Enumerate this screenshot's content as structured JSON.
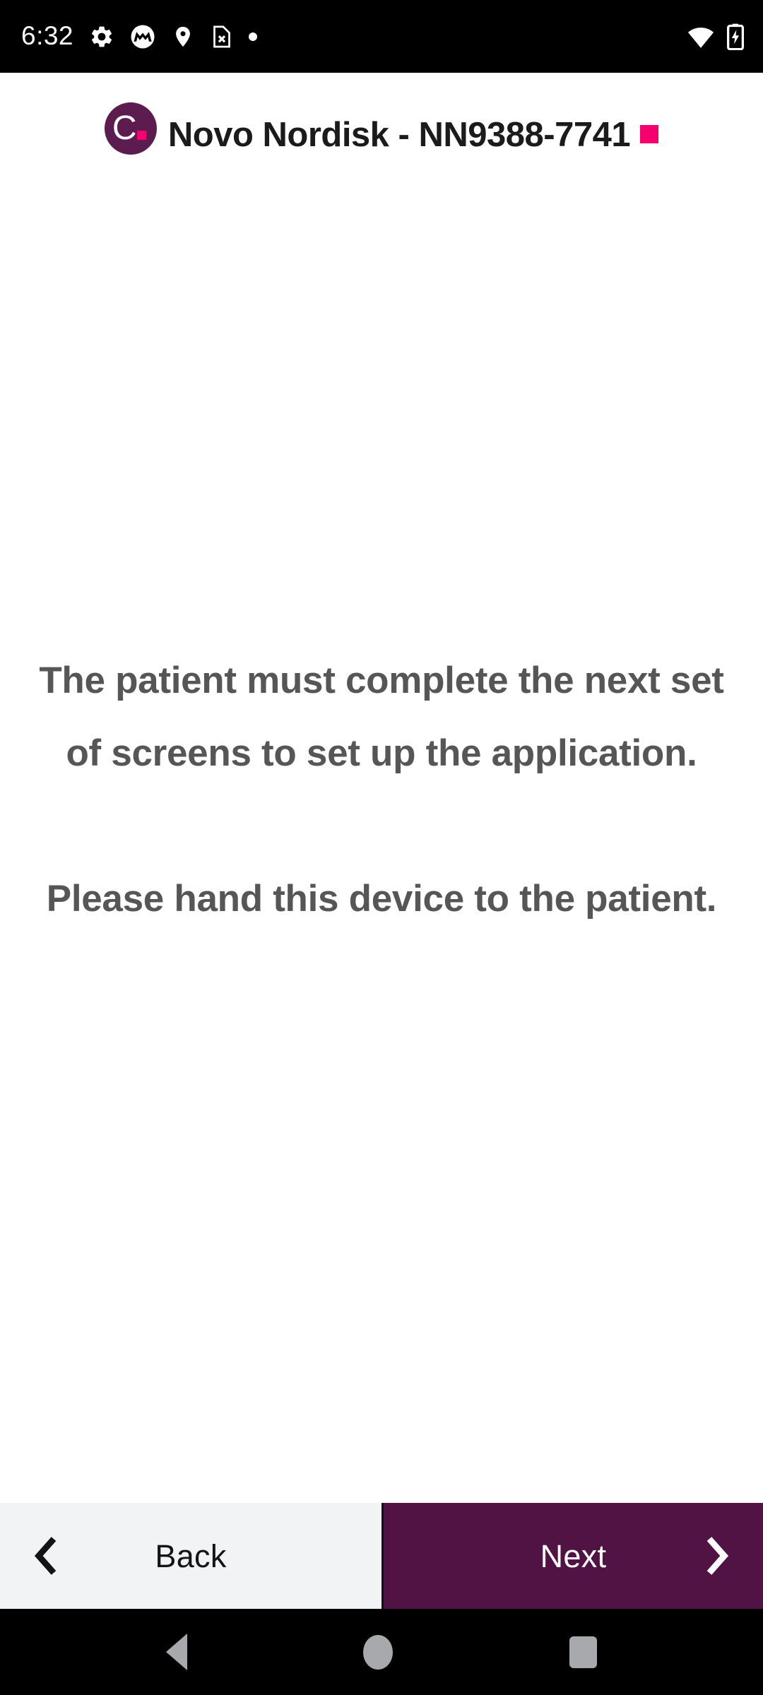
{
  "status_bar": {
    "clock": "6:32",
    "left_icons": [
      {
        "name": "settings-gear-icon",
        "label": "Settings"
      },
      {
        "name": "motorola-logo-icon",
        "label": "Motorola"
      },
      {
        "name": "location-pin-icon",
        "label": "Location"
      },
      {
        "name": "sim-card-missing-icon",
        "label": "No SIM"
      },
      {
        "name": "notification-dot-icon",
        "label": "Notification"
      }
    ],
    "right_icons": [
      {
        "name": "wifi-icon",
        "label": "Wi-Fi"
      },
      {
        "name": "battery-charging-icon",
        "label": "Battery charging"
      }
    ],
    "background_color": "#000000",
    "foreground_color": "#ffffff"
  },
  "header": {
    "logo_letter": "C.",
    "logo_background_color": "#5d1c50",
    "title": "Novo Nordisk - NN9388-7741",
    "accent_square_color": "#f5006e",
    "title_color": "#1b1b1b"
  },
  "main": {
    "paragraphs": [
      "The patient must complete the next set of screens to set up the application.",
      "Please hand this device to the patient."
    ],
    "text_color": "#565657",
    "background_color": "#ffffff"
  },
  "footer": {
    "back_label": "Back",
    "next_label": "Next",
    "back_background_color": "#f1f3f4",
    "back_text_color": "#141414",
    "next_background_color": "#511343",
    "next_text_color": "#ffffff",
    "back_icon": "chevron-left-icon",
    "next_icon": "chevron-right-icon"
  },
  "android_nav": {
    "background_color": "#000000",
    "glyph_color": "#a8a9ad",
    "buttons": [
      {
        "name": "android-back-button",
        "label": "Back"
      },
      {
        "name": "android-home-button",
        "label": "Home"
      },
      {
        "name": "android-recents-button",
        "label": "Recent apps"
      }
    ]
  }
}
